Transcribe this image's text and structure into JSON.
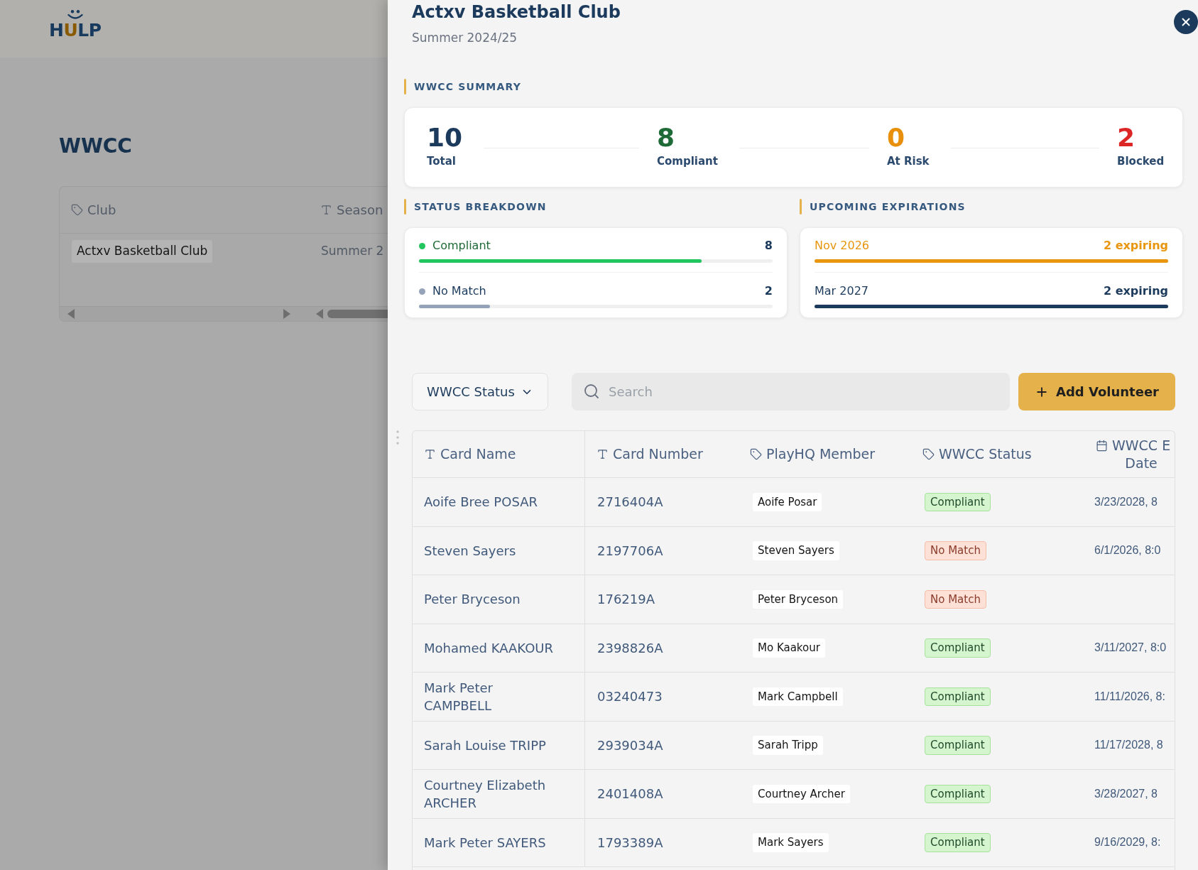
{
  "background_page": {
    "logo": {
      "letters": [
        {
          "text": "H",
          "accent": false
        },
        {
          "text": "U",
          "accent": true
        },
        {
          "text": "LP",
          "accent": false
        }
      ]
    },
    "title": "WWCC",
    "table": {
      "columns": [
        {
          "label": "Club",
          "kind": "tag"
        },
        {
          "label": "Season",
          "kind": "text"
        }
      ],
      "rows": [
        {
          "club": "Actxv Basketball Club",
          "season": "Summer 2"
        }
      ]
    }
  },
  "drawer": {
    "title": "Actxv Basketball Club",
    "subtitle": "Summer 2024/25",
    "summary": {
      "heading": "WWCC SUMMARY",
      "stats": [
        {
          "value": "10",
          "label": "Total",
          "color": "#1b3a5c"
        },
        {
          "value": "8",
          "label": "Compliant",
          "color": "#1e6b37"
        },
        {
          "value": "0",
          "label": "At Risk",
          "color": "#e8900c"
        },
        {
          "value": "2",
          "label": "Blocked",
          "color": "#dc2626"
        }
      ]
    },
    "status_breakdown": {
      "heading": "STATUS BREAKDOWN",
      "items": [
        {
          "label": "Compliant",
          "count": "8",
          "compliant": true,
          "color": "#22c55e",
          "level": 0.8
        },
        {
          "label": "No Match",
          "count": "2",
          "compliant": false,
          "color": "#94a3b8",
          "level": 0.2
        }
      ]
    },
    "upcoming_expirations": {
      "heading": "UPCOMING EXPIRATIONS",
      "items": [
        {
          "month": "Nov 2026",
          "count": "2 expiring",
          "color": "#e8960f"
        },
        {
          "month": "Mar 2027",
          "count": "2 expiring",
          "color": "#1b3a5c"
        }
      ]
    },
    "toolbar": {
      "filter": {
        "label": "WWCC Status"
      },
      "search": {
        "placeholder": "Search"
      },
      "add_button": {
        "label": "Add Volunteer"
      }
    },
    "table": {
      "columns": [
        {
          "label": "Card Name",
          "kind": "text"
        },
        {
          "label": "Card Number",
          "kind": "text"
        },
        {
          "label": "PlayHQ Member",
          "kind": "tag"
        },
        {
          "label": "WWCC Status",
          "kind": "tag"
        },
        {
          "label": "WWCC E\nDate",
          "kind": "date"
        }
      ],
      "rows": [
        {
          "card_name": "Aoife Bree POSAR",
          "card_number": "2716404A",
          "playhq_member": "Aoife Posar",
          "wwcc_status": "Compliant",
          "compliant": true,
          "expiry": "3/23/2028, 8"
        },
        {
          "card_name": "Steven Sayers",
          "card_number": "2197706A",
          "playhq_member": "Steven Sayers",
          "wwcc_status": "No Match",
          "compliant": false,
          "expiry": "6/1/2026, 8:0"
        },
        {
          "card_name": "Peter Bryceson",
          "card_number": "176219A",
          "playhq_member": "Peter Bryceson",
          "wwcc_status": "No Match",
          "compliant": false
        },
        {
          "card_name": "Mohamed KAAKOUR",
          "card_number": "2398826A",
          "playhq_member": "Mo Kaakour",
          "wwcc_status": "Compliant",
          "compliant": true,
          "expiry": "3/11/2027, 8:0"
        },
        {
          "card_name": "Mark Peter CAMPBELL",
          "card_number": "03240473",
          "playhq_member": "Mark Campbell",
          "wwcc_status": "Compliant",
          "compliant": true,
          "expiry": "11/11/2026, 8:"
        },
        {
          "card_name": "Sarah Louise TRIPP",
          "card_number": "2939034A",
          "playhq_member": "Sarah Tripp",
          "wwcc_status": "Compliant",
          "compliant": true,
          "expiry": "11/17/2028, 8"
        },
        {
          "card_name": "Courtney Elizabeth ARCHER",
          "card_number": "2401408A",
          "playhq_member": "Courtney Archer",
          "wwcc_status": "Compliant",
          "compliant": true,
          "expiry": "3/28/2027, 8"
        },
        {
          "card_name": "Mark Peter SAYERS",
          "card_number": "1793389A",
          "playhq_member": "Mark Sayers",
          "wwcc_status": "Compliant",
          "compliant": true,
          "expiry": "9/16/2029, 8:"
        }
      ]
    }
  }
}
